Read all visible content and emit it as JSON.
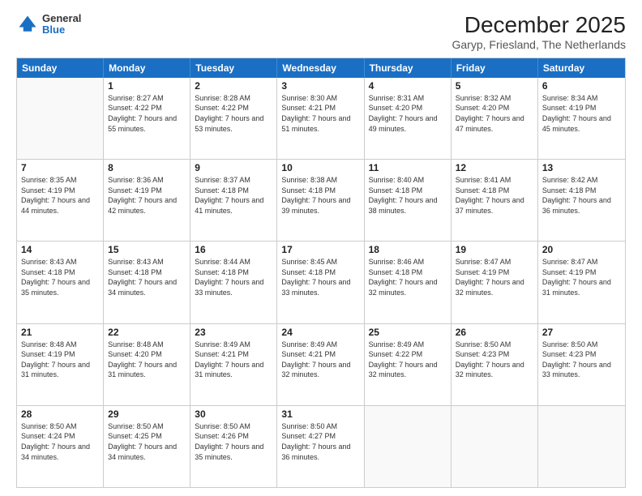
{
  "header": {
    "logo_line1": "General",
    "logo_line2": "Blue",
    "title": "December 2025",
    "subtitle": "Garyp, Friesland, The Netherlands"
  },
  "calendar": {
    "weekdays": [
      "Sunday",
      "Monday",
      "Tuesday",
      "Wednesday",
      "Thursday",
      "Friday",
      "Saturday"
    ],
    "weeks": [
      [
        {
          "day": "",
          "empty": true
        },
        {
          "day": "1",
          "sunrise": "8:27 AM",
          "sunset": "4:22 PM",
          "daylight": "7 hours and 55 minutes."
        },
        {
          "day": "2",
          "sunrise": "8:28 AM",
          "sunset": "4:22 PM",
          "daylight": "7 hours and 53 minutes."
        },
        {
          "day": "3",
          "sunrise": "8:30 AM",
          "sunset": "4:21 PM",
          "daylight": "7 hours and 51 minutes."
        },
        {
          "day": "4",
          "sunrise": "8:31 AM",
          "sunset": "4:20 PM",
          "daylight": "7 hours and 49 minutes."
        },
        {
          "day": "5",
          "sunrise": "8:32 AM",
          "sunset": "4:20 PM",
          "daylight": "7 hours and 47 minutes."
        },
        {
          "day": "6",
          "sunrise": "8:34 AM",
          "sunset": "4:19 PM",
          "daylight": "7 hours and 45 minutes."
        }
      ],
      [
        {
          "day": "7",
          "sunrise": "8:35 AM",
          "sunset": "4:19 PM",
          "daylight": "7 hours and 44 minutes."
        },
        {
          "day": "8",
          "sunrise": "8:36 AM",
          "sunset": "4:19 PM",
          "daylight": "7 hours and 42 minutes."
        },
        {
          "day": "9",
          "sunrise": "8:37 AM",
          "sunset": "4:18 PM",
          "daylight": "7 hours and 41 minutes."
        },
        {
          "day": "10",
          "sunrise": "8:38 AM",
          "sunset": "4:18 PM",
          "daylight": "7 hours and 39 minutes."
        },
        {
          "day": "11",
          "sunrise": "8:40 AM",
          "sunset": "4:18 PM",
          "daylight": "7 hours and 38 minutes."
        },
        {
          "day": "12",
          "sunrise": "8:41 AM",
          "sunset": "4:18 PM",
          "daylight": "7 hours and 37 minutes."
        },
        {
          "day": "13",
          "sunrise": "8:42 AM",
          "sunset": "4:18 PM",
          "daylight": "7 hours and 36 minutes."
        }
      ],
      [
        {
          "day": "14",
          "sunrise": "8:43 AM",
          "sunset": "4:18 PM",
          "daylight": "7 hours and 35 minutes."
        },
        {
          "day": "15",
          "sunrise": "8:43 AM",
          "sunset": "4:18 PM",
          "daylight": "7 hours and 34 minutes."
        },
        {
          "day": "16",
          "sunrise": "8:44 AM",
          "sunset": "4:18 PM",
          "daylight": "7 hours and 33 minutes."
        },
        {
          "day": "17",
          "sunrise": "8:45 AM",
          "sunset": "4:18 PM",
          "daylight": "7 hours and 33 minutes."
        },
        {
          "day": "18",
          "sunrise": "8:46 AM",
          "sunset": "4:18 PM",
          "daylight": "7 hours and 32 minutes."
        },
        {
          "day": "19",
          "sunrise": "8:47 AM",
          "sunset": "4:19 PM",
          "daylight": "7 hours and 32 minutes."
        },
        {
          "day": "20",
          "sunrise": "8:47 AM",
          "sunset": "4:19 PM",
          "daylight": "7 hours and 31 minutes."
        }
      ],
      [
        {
          "day": "21",
          "sunrise": "8:48 AM",
          "sunset": "4:19 PM",
          "daylight": "7 hours and 31 minutes."
        },
        {
          "day": "22",
          "sunrise": "8:48 AM",
          "sunset": "4:20 PM",
          "daylight": "7 hours and 31 minutes."
        },
        {
          "day": "23",
          "sunrise": "8:49 AM",
          "sunset": "4:21 PM",
          "daylight": "7 hours and 31 minutes."
        },
        {
          "day": "24",
          "sunrise": "8:49 AM",
          "sunset": "4:21 PM",
          "daylight": "7 hours and 32 minutes."
        },
        {
          "day": "25",
          "sunrise": "8:49 AM",
          "sunset": "4:22 PM",
          "daylight": "7 hours and 32 minutes."
        },
        {
          "day": "26",
          "sunrise": "8:50 AM",
          "sunset": "4:23 PM",
          "daylight": "7 hours and 32 minutes."
        },
        {
          "day": "27",
          "sunrise": "8:50 AM",
          "sunset": "4:23 PM",
          "daylight": "7 hours and 33 minutes."
        }
      ],
      [
        {
          "day": "28",
          "sunrise": "8:50 AM",
          "sunset": "4:24 PM",
          "daylight": "7 hours and 34 minutes."
        },
        {
          "day": "29",
          "sunrise": "8:50 AM",
          "sunset": "4:25 PM",
          "daylight": "7 hours and 34 minutes."
        },
        {
          "day": "30",
          "sunrise": "8:50 AM",
          "sunset": "4:26 PM",
          "daylight": "7 hours and 35 minutes."
        },
        {
          "day": "31",
          "sunrise": "8:50 AM",
          "sunset": "4:27 PM",
          "daylight": "7 hours and 36 minutes."
        },
        {
          "day": "",
          "empty": true
        },
        {
          "day": "",
          "empty": true
        },
        {
          "day": "",
          "empty": true
        }
      ]
    ]
  }
}
